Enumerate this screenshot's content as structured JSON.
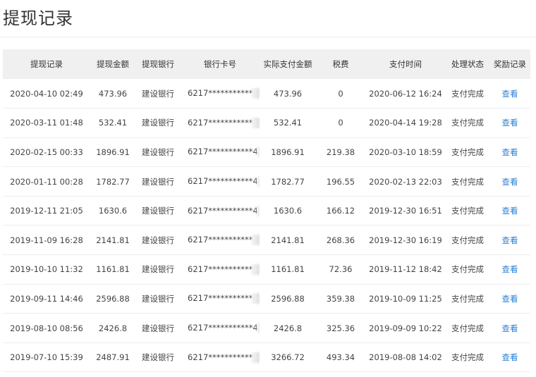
{
  "page": {
    "title": "提现记录"
  },
  "table": {
    "headers": [
      "提现记录",
      "提现金额",
      "提现银行",
      "银行卡号",
      "实际支付金额",
      "税费",
      "支付时间",
      "处理状态",
      "奖励记录"
    ],
    "rows": [
      {
        "time": "2020-04-10 02:49",
        "amount": "473.96",
        "bank": "建设银行",
        "card": "6217***********",
        "paid": "473.96",
        "tax": "0",
        "pay_time": "2020-06-12 16:24",
        "status": "支付完成",
        "action": "查看"
      },
      {
        "time": "2020-03-11 01:48",
        "amount": "532.41",
        "bank": "建设银行",
        "card": "6217***********",
        "paid": "532.41",
        "tax": "0",
        "pay_time": "2020-04-14 19:28",
        "status": "支付完成",
        "action": "查看"
      },
      {
        "time": "2020-02-15 00:33",
        "amount": "1896.91",
        "bank": "建设银行",
        "card": "6217***********4",
        "paid": "1896.91",
        "tax": "219.38",
        "pay_time": "2020-03-10 18:59",
        "status": "支付完成",
        "action": "查看"
      },
      {
        "time": "2020-01-11 00:28",
        "amount": "1782.77",
        "bank": "建设银行",
        "card": "6217***********4",
        "paid": "1782.77",
        "tax": "196.55",
        "pay_time": "2020-02-13 22:03",
        "status": "支付完成",
        "action": "查看"
      },
      {
        "time": "2019-12-11 21:05",
        "amount": "1630.6",
        "bank": "建设银行",
        "card": "6217***********4",
        "paid": "1630.6",
        "tax": "166.12",
        "pay_time": "2019-12-30 16:51",
        "status": "支付完成",
        "action": "查看"
      },
      {
        "time": "2019-11-09 16:28",
        "amount": "2141.81",
        "bank": "建设银行",
        "card": "6217***********",
        "paid": "2141.81",
        "tax": "268.36",
        "pay_time": "2019-12-30 16:19",
        "status": "支付完成",
        "action": "查看"
      },
      {
        "time": "2019-10-10 11:32",
        "amount": "1161.81",
        "bank": "建设银行",
        "card": "6217***********",
        "paid": "1161.81",
        "tax": "72.36",
        "pay_time": "2019-11-12 18:42",
        "status": "支付完成",
        "action": "查看"
      },
      {
        "time": "2019-09-11 14:46",
        "amount": "2596.88",
        "bank": "建设银行",
        "card": "6217***********",
        "paid": "2596.88",
        "tax": "359.38",
        "pay_time": "2019-10-09 11:25",
        "status": "支付完成",
        "action": "查看"
      },
      {
        "time": "2019-08-10 08:56",
        "amount": "2426.8",
        "bank": "建设银行",
        "card": "6217***********4",
        "paid": "2426.8",
        "tax": "325.36",
        "pay_time": "2019-09-09 10:22",
        "status": "支付完成",
        "action": "查看"
      },
      {
        "time": "2019-07-10 15:39",
        "amount": "2487.91",
        "bank": "建设银行",
        "card": "6217***********",
        "paid": "3266.72",
        "tax": "493.34",
        "pay_time": "2019-08-08 14:02",
        "status": "支付完成",
        "action": "查看"
      }
    ]
  },
  "colors": {
    "link": "#2d7fd3",
    "header_bg": "#f0f0f0",
    "row_border": "#eeeeee"
  }
}
